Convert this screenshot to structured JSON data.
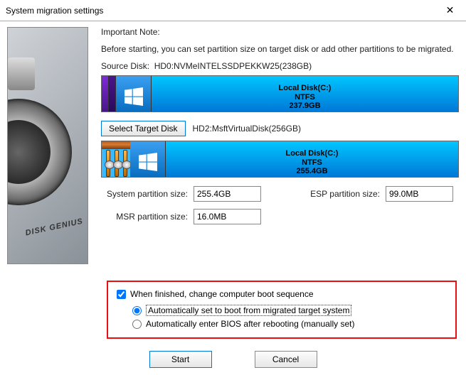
{
  "window": {
    "title": "System migration settings"
  },
  "notes": {
    "title": "Important Note:",
    "body": "Before starting, you can set partition size on target disk or add other partitions to be migrated."
  },
  "source": {
    "label": "Source Disk:",
    "value": "HD0:NVMeINTELSSDPEKKW25(238GB)",
    "partition": {
      "name": "Local Disk(C:)",
      "fs": "NTFS",
      "size": "237.9GB"
    }
  },
  "target": {
    "button": "Select Target Disk",
    "value": "HD2:MsftVirtualDisk(256GB)",
    "partition": {
      "name": "Local Disk(C:)",
      "fs": "NTFS",
      "size": "255.4GB"
    }
  },
  "sizes": {
    "system_label": "System partition size:",
    "system_value": "255.4GB",
    "esp_label": "ESP partition size:",
    "esp_value": "99.0MB",
    "msr_label": "MSR partition size:",
    "msr_value": "16.0MB"
  },
  "boot": {
    "checkbox": "When finished, change computer boot sequence",
    "radio1": "Automatically set to boot from migrated target system",
    "radio2": "Automatically enter BIOS after rebooting (manually set)"
  },
  "footer": {
    "start": "Start",
    "cancel": "Cancel"
  },
  "sidebar": {
    "brand": "DISK GENIUS"
  }
}
